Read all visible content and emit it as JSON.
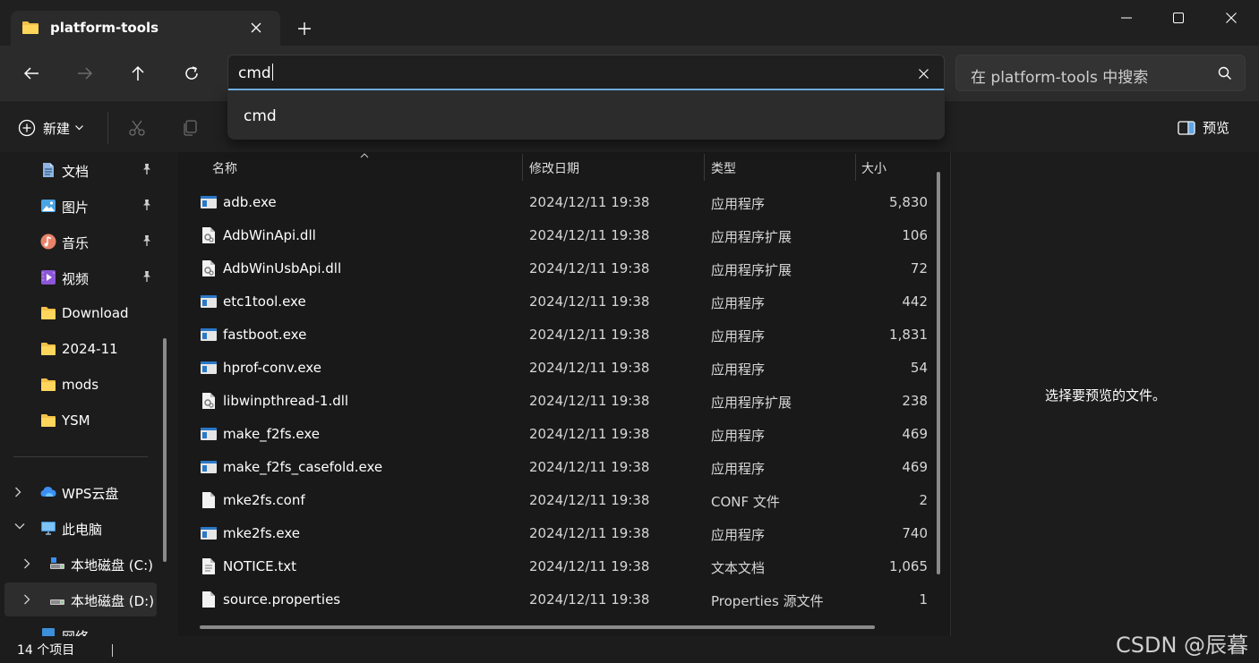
{
  "window": {
    "tab_title": "platform-tools",
    "new_tab_symbol": "+"
  },
  "address_bar": {
    "value": "cmd",
    "suggestion": "cmd"
  },
  "search": {
    "placeholder": "在 platform-tools 中搜索"
  },
  "command_bar": {
    "new_label": "新建",
    "preview_label": "预览"
  },
  "sidebar": {
    "pinned": [
      {
        "label": "文档",
        "icon": "document-icon"
      },
      {
        "label": "图片",
        "icon": "pictures-icon"
      },
      {
        "label": "音乐",
        "icon": "music-icon"
      },
      {
        "label": "视频",
        "icon": "video-icon"
      }
    ],
    "folders": [
      "Download",
      "2024-11",
      "mods",
      "YSM"
    ],
    "tree": [
      {
        "label": "WPS云盘",
        "icon": "cloud-icon"
      },
      {
        "label": "此电脑",
        "icon": "computer-icon"
      },
      {
        "label": "本地磁盘 (C:)",
        "icon": "drive-icon"
      },
      {
        "label": "本地磁盘 (D:)",
        "icon": "drive-icon"
      },
      {
        "label": "网络",
        "icon": "network-icon"
      }
    ]
  },
  "columns": {
    "name": "名称",
    "modified": "修改日期",
    "type": "类型",
    "size": "大小"
  },
  "files": [
    {
      "name": "adb.exe",
      "date": "2024/12/11 19:38",
      "type": "应用程序",
      "size": "5,830",
      "icon": "exe"
    },
    {
      "name": "AdbWinApi.dll",
      "date": "2024/12/11 19:38",
      "type": "应用程序扩展",
      "size": "106",
      "icon": "dll"
    },
    {
      "name": "AdbWinUsbApi.dll",
      "date": "2024/12/11 19:38",
      "type": "应用程序扩展",
      "size": "72",
      "icon": "dll"
    },
    {
      "name": "etc1tool.exe",
      "date": "2024/12/11 19:38",
      "type": "应用程序",
      "size": "442",
      "icon": "exe"
    },
    {
      "name": "fastboot.exe",
      "date": "2024/12/11 19:38",
      "type": "应用程序",
      "size": "1,831",
      "icon": "exe"
    },
    {
      "name": "hprof-conv.exe",
      "date": "2024/12/11 19:38",
      "type": "应用程序",
      "size": "54",
      "icon": "exe"
    },
    {
      "name": "libwinpthread-1.dll",
      "date": "2024/12/11 19:38",
      "type": "应用程序扩展",
      "size": "238",
      "icon": "dll"
    },
    {
      "name": "make_f2fs.exe",
      "date": "2024/12/11 19:38",
      "type": "应用程序",
      "size": "469",
      "icon": "exe"
    },
    {
      "name": "make_f2fs_casefold.exe",
      "date": "2024/12/11 19:38",
      "type": "应用程序",
      "size": "469",
      "icon": "exe"
    },
    {
      "name": "mke2fs.conf",
      "date": "2024/12/11 19:38",
      "type": "CONF 文件",
      "size": "2",
      "icon": "file"
    },
    {
      "name": "mke2fs.exe",
      "date": "2024/12/11 19:38",
      "type": "应用程序",
      "size": "740",
      "icon": "exe"
    },
    {
      "name": "NOTICE.txt",
      "date": "2024/12/11 19:38",
      "type": "文本文档",
      "size": "1,065",
      "icon": "txt"
    },
    {
      "name": "source.properties",
      "date": "2024/12/11 19:38",
      "type": "Properties 源文件",
      "size": "1",
      "icon": "file"
    }
  ],
  "preview": {
    "message": "选择要预览的文件。"
  },
  "status": {
    "count": "14 个项目"
  },
  "watermark": "CSDN @辰暮"
}
